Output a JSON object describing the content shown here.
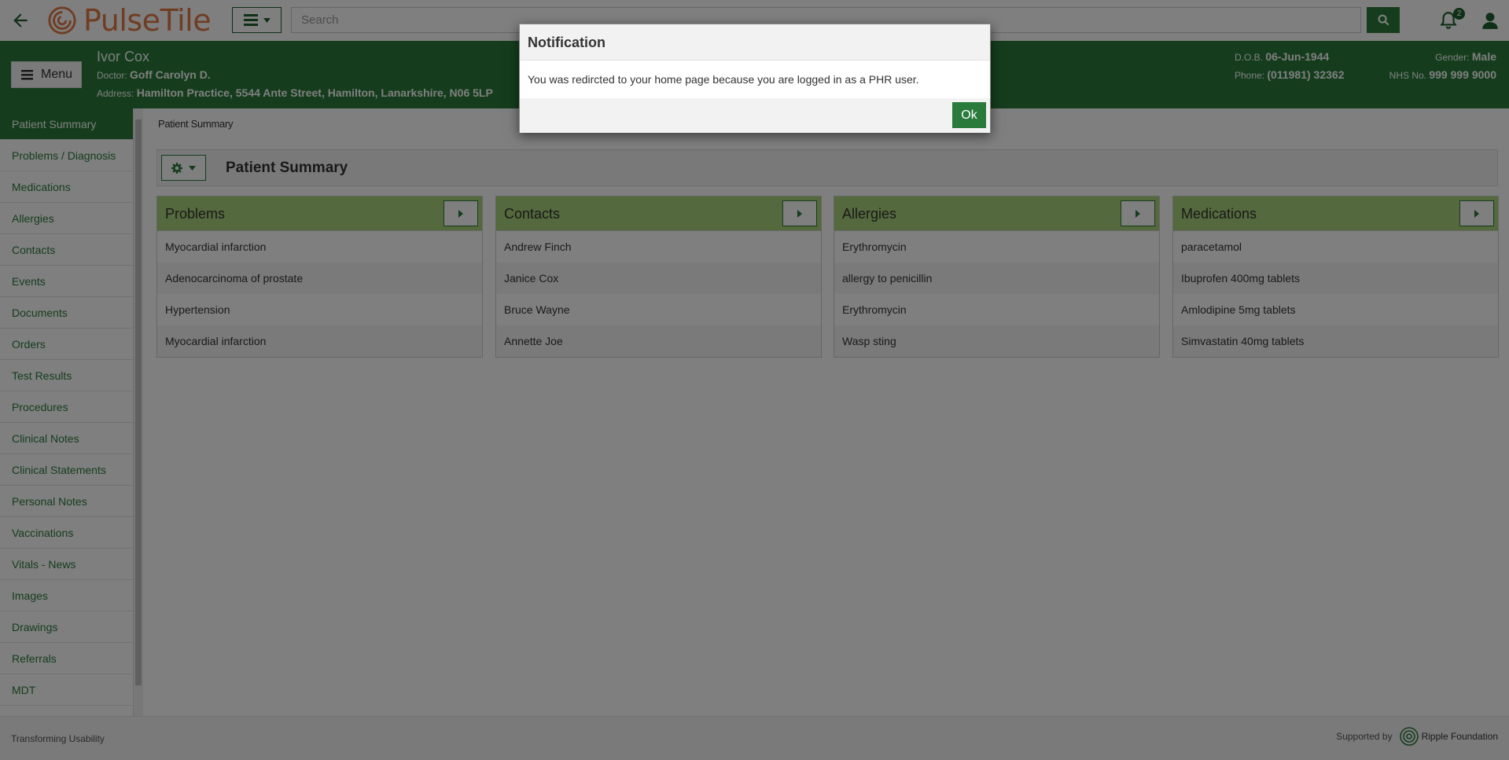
{
  "app": {
    "logo_text": "PulseTile"
  },
  "search": {
    "placeholder": "Search"
  },
  "notifications": {
    "count": "2"
  },
  "banner": {
    "menu_label": "Menu",
    "patient_name": "Ivor Cox",
    "doctor_label": "Doctor:",
    "doctor": "Goff Carolyn D.",
    "address_label": "Address:",
    "address": "Hamilton Practice, 5544 Ante Street, Hamilton, Lanarkshire, N06 5LP",
    "dob_label": "D.O.B.",
    "dob": "06-Jun-1944",
    "phone_label": "Phone:",
    "phone": "(011981) 32362",
    "gender_label": "Gender:",
    "gender": "Male",
    "nhs_label": "NHS No.",
    "nhs": "999 999 9000"
  },
  "sidebar": {
    "items": [
      "Patient Summary",
      "Problems / Diagnosis",
      "Medications",
      "Allergies",
      "Contacts",
      "Events",
      "Documents",
      "Orders",
      "Test Results",
      "Procedures",
      "Clinical Notes",
      "Clinical Statements",
      "Personal Notes",
      "Vaccinations",
      "Vitals - News",
      "Images",
      "Drawings",
      "Referrals",
      "MDT"
    ]
  },
  "content": {
    "breadcrumb": "Patient Summary",
    "title": "Patient Summary",
    "cards": [
      {
        "title": "Problems",
        "items": [
          "Myocardial infarction",
          "Adenocarcinoma of prostate",
          "Hypertension",
          "Myocardial infarction"
        ]
      },
      {
        "title": "Contacts",
        "items": [
          "Andrew Finch",
          "Janice Cox",
          "Bruce Wayne",
          "Annette Joe"
        ]
      },
      {
        "title": "Allergies",
        "items": [
          "Erythromycin",
          "allergy to penicillin",
          "Erythromycin",
          "Wasp sting"
        ]
      },
      {
        "title": "Medications",
        "items": [
          "paracetamol",
          "Ibuprofen 400mg tablets",
          "Amlodipine 5mg tablets",
          "Simvastatin 40mg tablets"
        ]
      }
    ]
  },
  "footer": {
    "left": "Transforming Usability",
    "supported_by": "Supported by",
    "sponsor": "Ripple Foundation"
  },
  "modal": {
    "title": "Notification",
    "message": "You was redircted to your home page because you are logged in as a PHR user.",
    "ok_label": "Ok"
  },
  "colors": {
    "brand_green": "#2a7a3b",
    "card_header": "#a9d27a",
    "logo_orange": "#e07a47"
  }
}
